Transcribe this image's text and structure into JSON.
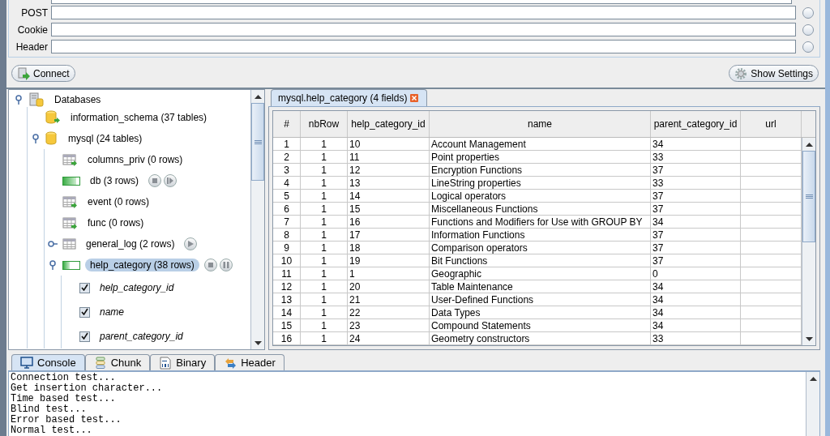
{
  "request": {
    "fields": [
      {
        "label": "POST",
        "selected": false
      },
      {
        "label": "Cookie",
        "selected": false
      },
      {
        "label": "Header",
        "selected": false
      }
    ]
  },
  "buttons": {
    "connect": "Connect",
    "settings": "Show Settings"
  },
  "tree": {
    "label": "Databases",
    "kind": "root",
    "expanded": true,
    "children": [
      {
        "label": "information_schema (37 tables)",
        "kind": "database-loadable"
      },
      {
        "label": "mysql (24 tables)",
        "kind": "database",
        "expanded": true,
        "children": [
          {
            "label": "columns_priv (0 rows)",
            "kind": "table-loadable",
            "selected": false
          },
          {
            "label": "db (3 rows)",
            "kind": "table-loading",
            "level": 0.8,
            "selected": false,
            "actions": [
              {
                "kind": "stop"
              },
              {
                "kind": "resume"
              }
            ]
          },
          {
            "label": "event (0 rows)",
            "kind": "table-loadable",
            "selected": false
          },
          {
            "label": "func (0 rows)",
            "kind": "table-loadable",
            "selected": false
          },
          {
            "label": "general_log (2 rows)",
            "kind": "table",
            "expanded": false,
            "selected": false,
            "actions": [
              {
                "kind": "play"
              }
            ]
          },
          {
            "label": "help_category (38 rows)",
            "kind": "table-loading",
            "level": 0.4,
            "expanded": true,
            "selected": true,
            "actions": [
              {
                "kind": "stop"
              },
              {
                "kind": "pause"
              }
            ],
            "children": [
              {
                "label": "help_category_id",
                "kind": "column",
                "checked": true
              },
              {
                "label": "name",
                "kind": "column",
                "checked": true
              },
              {
                "label": "parent_category_id",
                "kind": "column",
                "checked": true
              }
            ]
          }
        ]
      }
    ]
  },
  "result_tabs": [
    {
      "label": "mysql.help_category (4 fields)",
      "selected": true
    }
  ],
  "table": {
    "columns": [
      "#",
      "nbRow",
      "help_category_id",
      "name",
      "parent_category_id",
      "url"
    ],
    "rows": [
      [
        "1",
        "1",
        "10",
        "Account Management",
        "34",
        ""
      ],
      [
        "2",
        "1",
        "11",
        "Point properties",
        "33",
        ""
      ],
      [
        "3",
        "1",
        "12",
        "Encryption Functions",
        "37",
        ""
      ],
      [
        "4",
        "1",
        "13",
        "LineString properties",
        "33",
        ""
      ],
      [
        "5",
        "1",
        "14",
        "Logical operators",
        "37",
        ""
      ],
      [
        "6",
        "1",
        "15",
        "Miscellaneous Functions",
        "37",
        ""
      ],
      [
        "7",
        "1",
        "16",
        "Functions and Modifiers for Use with GROUP BY",
        "34",
        ""
      ],
      [
        "8",
        "1",
        "17",
        "Information Functions",
        "37",
        ""
      ],
      [
        "9",
        "1",
        "18",
        "Comparison operators",
        "37",
        ""
      ],
      [
        "10",
        "1",
        "19",
        "Bit Functions",
        "37",
        ""
      ],
      [
        "11",
        "1",
        "1",
        "Geographic",
        "0",
        ""
      ],
      [
        "12",
        "1",
        "20",
        "Table Maintenance",
        "34",
        ""
      ],
      [
        "13",
        "1",
        "21",
        "User-Defined Functions",
        "34",
        ""
      ],
      [
        "14",
        "1",
        "22",
        "Data Types",
        "34",
        ""
      ],
      [
        "15",
        "1",
        "23",
        "Compound Statements",
        "34",
        ""
      ],
      [
        "16",
        "1",
        "24",
        "Geometry constructors",
        "33",
        ""
      ]
    ]
  },
  "bottom_tabs": [
    {
      "label": "Console",
      "kind": "console",
      "selected": true
    },
    {
      "label": "Chunk",
      "kind": "chunk",
      "selected": false
    },
    {
      "label": "Binary",
      "kind": "binary",
      "selected": false
    },
    {
      "label": "Header",
      "kind": "header",
      "selected": false
    }
  ],
  "console": [
    "Connection test...",
    "Get insertion character...",
    "Time based test...",
    "Blind test...",
    "Error based test...",
    "Normal test..."
  ]
}
